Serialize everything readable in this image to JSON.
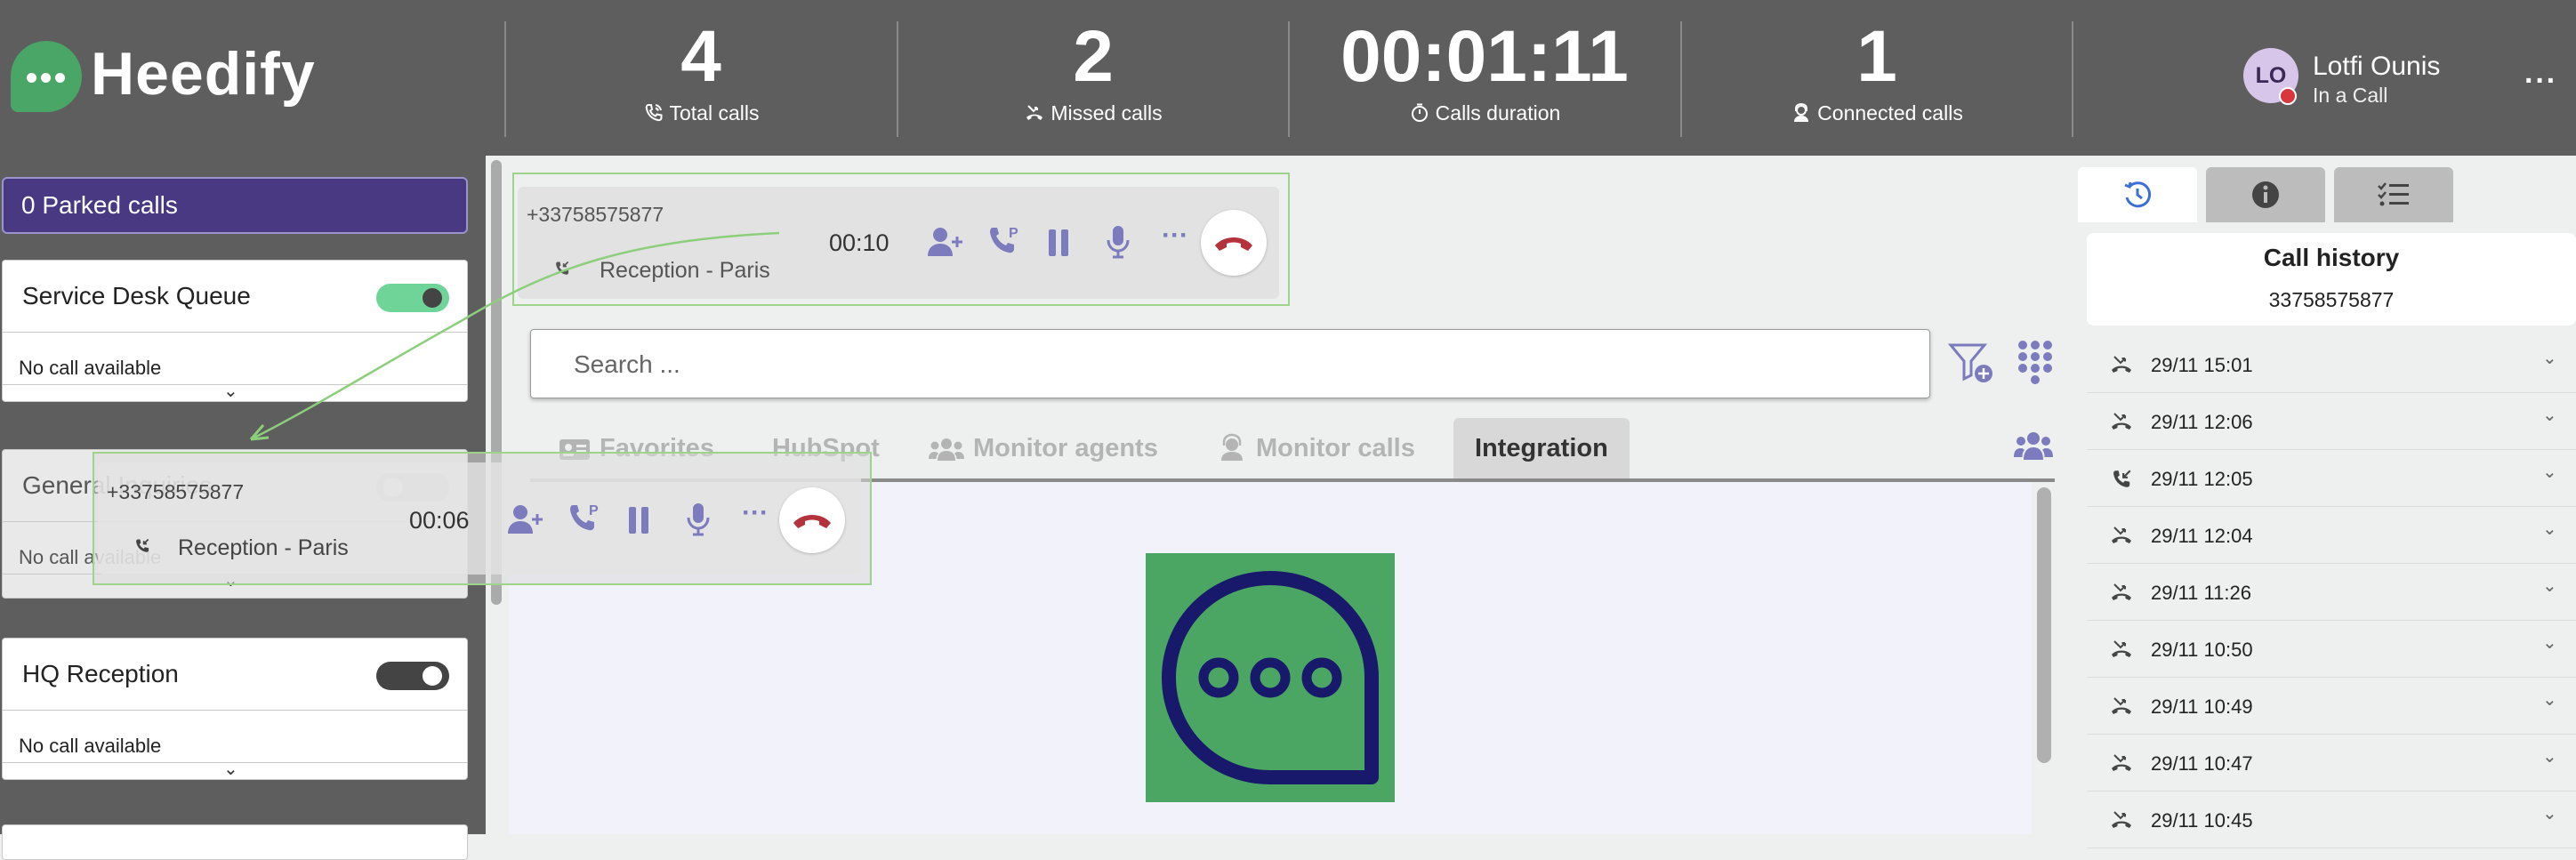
{
  "brand": {
    "name": "Heedify",
    "color": "#4aa667"
  },
  "stats": [
    {
      "value": "4",
      "label": "Total calls",
      "icon": "phone-ring-icon"
    },
    {
      "value": "2",
      "label": "Missed calls",
      "icon": "missed-call-icon"
    },
    {
      "value": "00:01:11",
      "label": "Calls duration",
      "icon": "timer-icon"
    },
    {
      "value": "1",
      "label": "Connected calls",
      "icon": "headset-user-icon"
    }
  ],
  "user": {
    "initials": "LO",
    "name": "Lotfi Ounis",
    "status": "In a Call",
    "more": "···"
  },
  "sidebar": {
    "parked": "0 Parked calls",
    "queues": [
      {
        "name": "Service Desk Queue",
        "empty": "No call available",
        "enabled": true
      },
      {
        "name": "General Inquiries",
        "empty": "No call available",
        "enabled": false
      },
      {
        "name": "HQ Reception",
        "empty": "No call available",
        "enabled": false
      }
    ]
  },
  "active_call": {
    "number": "+33758575877",
    "queue": "Reception - Paris",
    "timer": "00:10"
  },
  "dragged_call": {
    "number": "+33758575877",
    "queue": "Reception - Paris",
    "timer": "00:06"
  },
  "search": {
    "placeholder": "Search ..."
  },
  "tabs": [
    {
      "label": "Favorites",
      "icon": "contact-card-icon"
    },
    {
      "label": "HubSpot",
      "icon": ""
    },
    {
      "label": "Monitor agents",
      "icon": "users-icon"
    },
    {
      "label": "Monitor calls",
      "icon": "headset-icon"
    },
    {
      "label": "Integration",
      "icon": "",
      "active": true
    }
  ],
  "history": {
    "title": "Call history",
    "number": "33758575877",
    "items": [
      {
        "time": "29/11 15:01",
        "type": "missed"
      },
      {
        "time": "29/11 12:06",
        "type": "missed"
      },
      {
        "time": "29/11 12:05",
        "type": "incoming"
      },
      {
        "time": "29/11 12:04",
        "type": "missed"
      },
      {
        "time": "29/11 11:26",
        "type": "missed"
      },
      {
        "time": "29/11 10:50",
        "type": "missed"
      },
      {
        "time": "29/11 10:49",
        "type": "missed"
      },
      {
        "time": "29/11 10:47",
        "type": "missed"
      },
      {
        "time": "29/11 10:45",
        "type": "missed"
      }
    ]
  },
  "colors": {
    "header": "#5e5e5e",
    "accent": "#7b7bbd",
    "hangup": "#b4323c",
    "parked": "#493983",
    "toggle_on": "#6fd498"
  }
}
